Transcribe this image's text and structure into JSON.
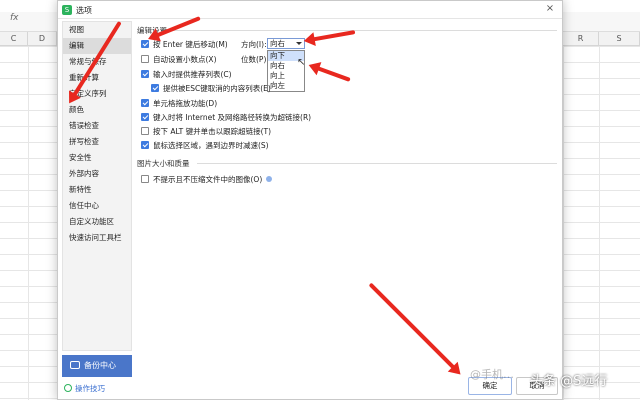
{
  "spreadsheet": {
    "fx_label": "fx",
    "columns_left": [
      "C",
      "D"
    ],
    "columns_right": [
      "R",
      "S"
    ]
  },
  "dialog": {
    "title": "选项",
    "close": "×"
  },
  "nav": {
    "items": [
      "视图",
      "编辑",
      "常规与保存",
      "重新计算",
      "自定义序列",
      "颜色",
      "错误检查",
      "拼写检查",
      "安全性",
      "外部内容",
      "新特性",
      "信任中心",
      "自定义功能区",
      "快速访问工具栏"
    ],
    "active_index": 1,
    "backup_label": "备份中心",
    "tips_label": "操作技巧"
  },
  "edit": {
    "section_title": "编辑设置",
    "opt_move_after_enter": "按 Enter 键后移动(M)",
    "direction_label": "方向(I):",
    "direction_value": "向右",
    "opt_auto_decimal": "自动设置小数点(X)",
    "digits_label": "位数(P):",
    "direction_options": [
      "向下",
      "向右",
      "向上",
      "向左"
    ],
    "opt_autocomplete": "输入时提供推荐列表(C)",
    "opt_esc_prompt": "提供被ESC键取消的内容列表(E)",
    "opt_drag_drop": "单元格拖放功能(D)",
    "opt_internet_links": "键入时将 Internet 及网络路径转换为超链接(R)",
    "opt_alt_click": "按下 ALT 键并单击以跟踪超链接(T)",
    "opt_mouse_slow": "鼠标选择区域，遇到边界时减速(S)"
  },
  "image": {
    "section_title": "图片大小和质量",
    "opt_no_compress": "不提示且不压缩文件中的图像(O)"
  },
  "buttons": {
    "ok": "确定",
    "cancel": "取消"
  },
  "watermark": {
    "text": "头条 @S远行",
    "faint": "@手机…"
  },
  "colors": {
    "accent": "#3d7be0",
    "backup_bg": "#4a76c9",
    "annotation": "#e8281f"
  }
}
